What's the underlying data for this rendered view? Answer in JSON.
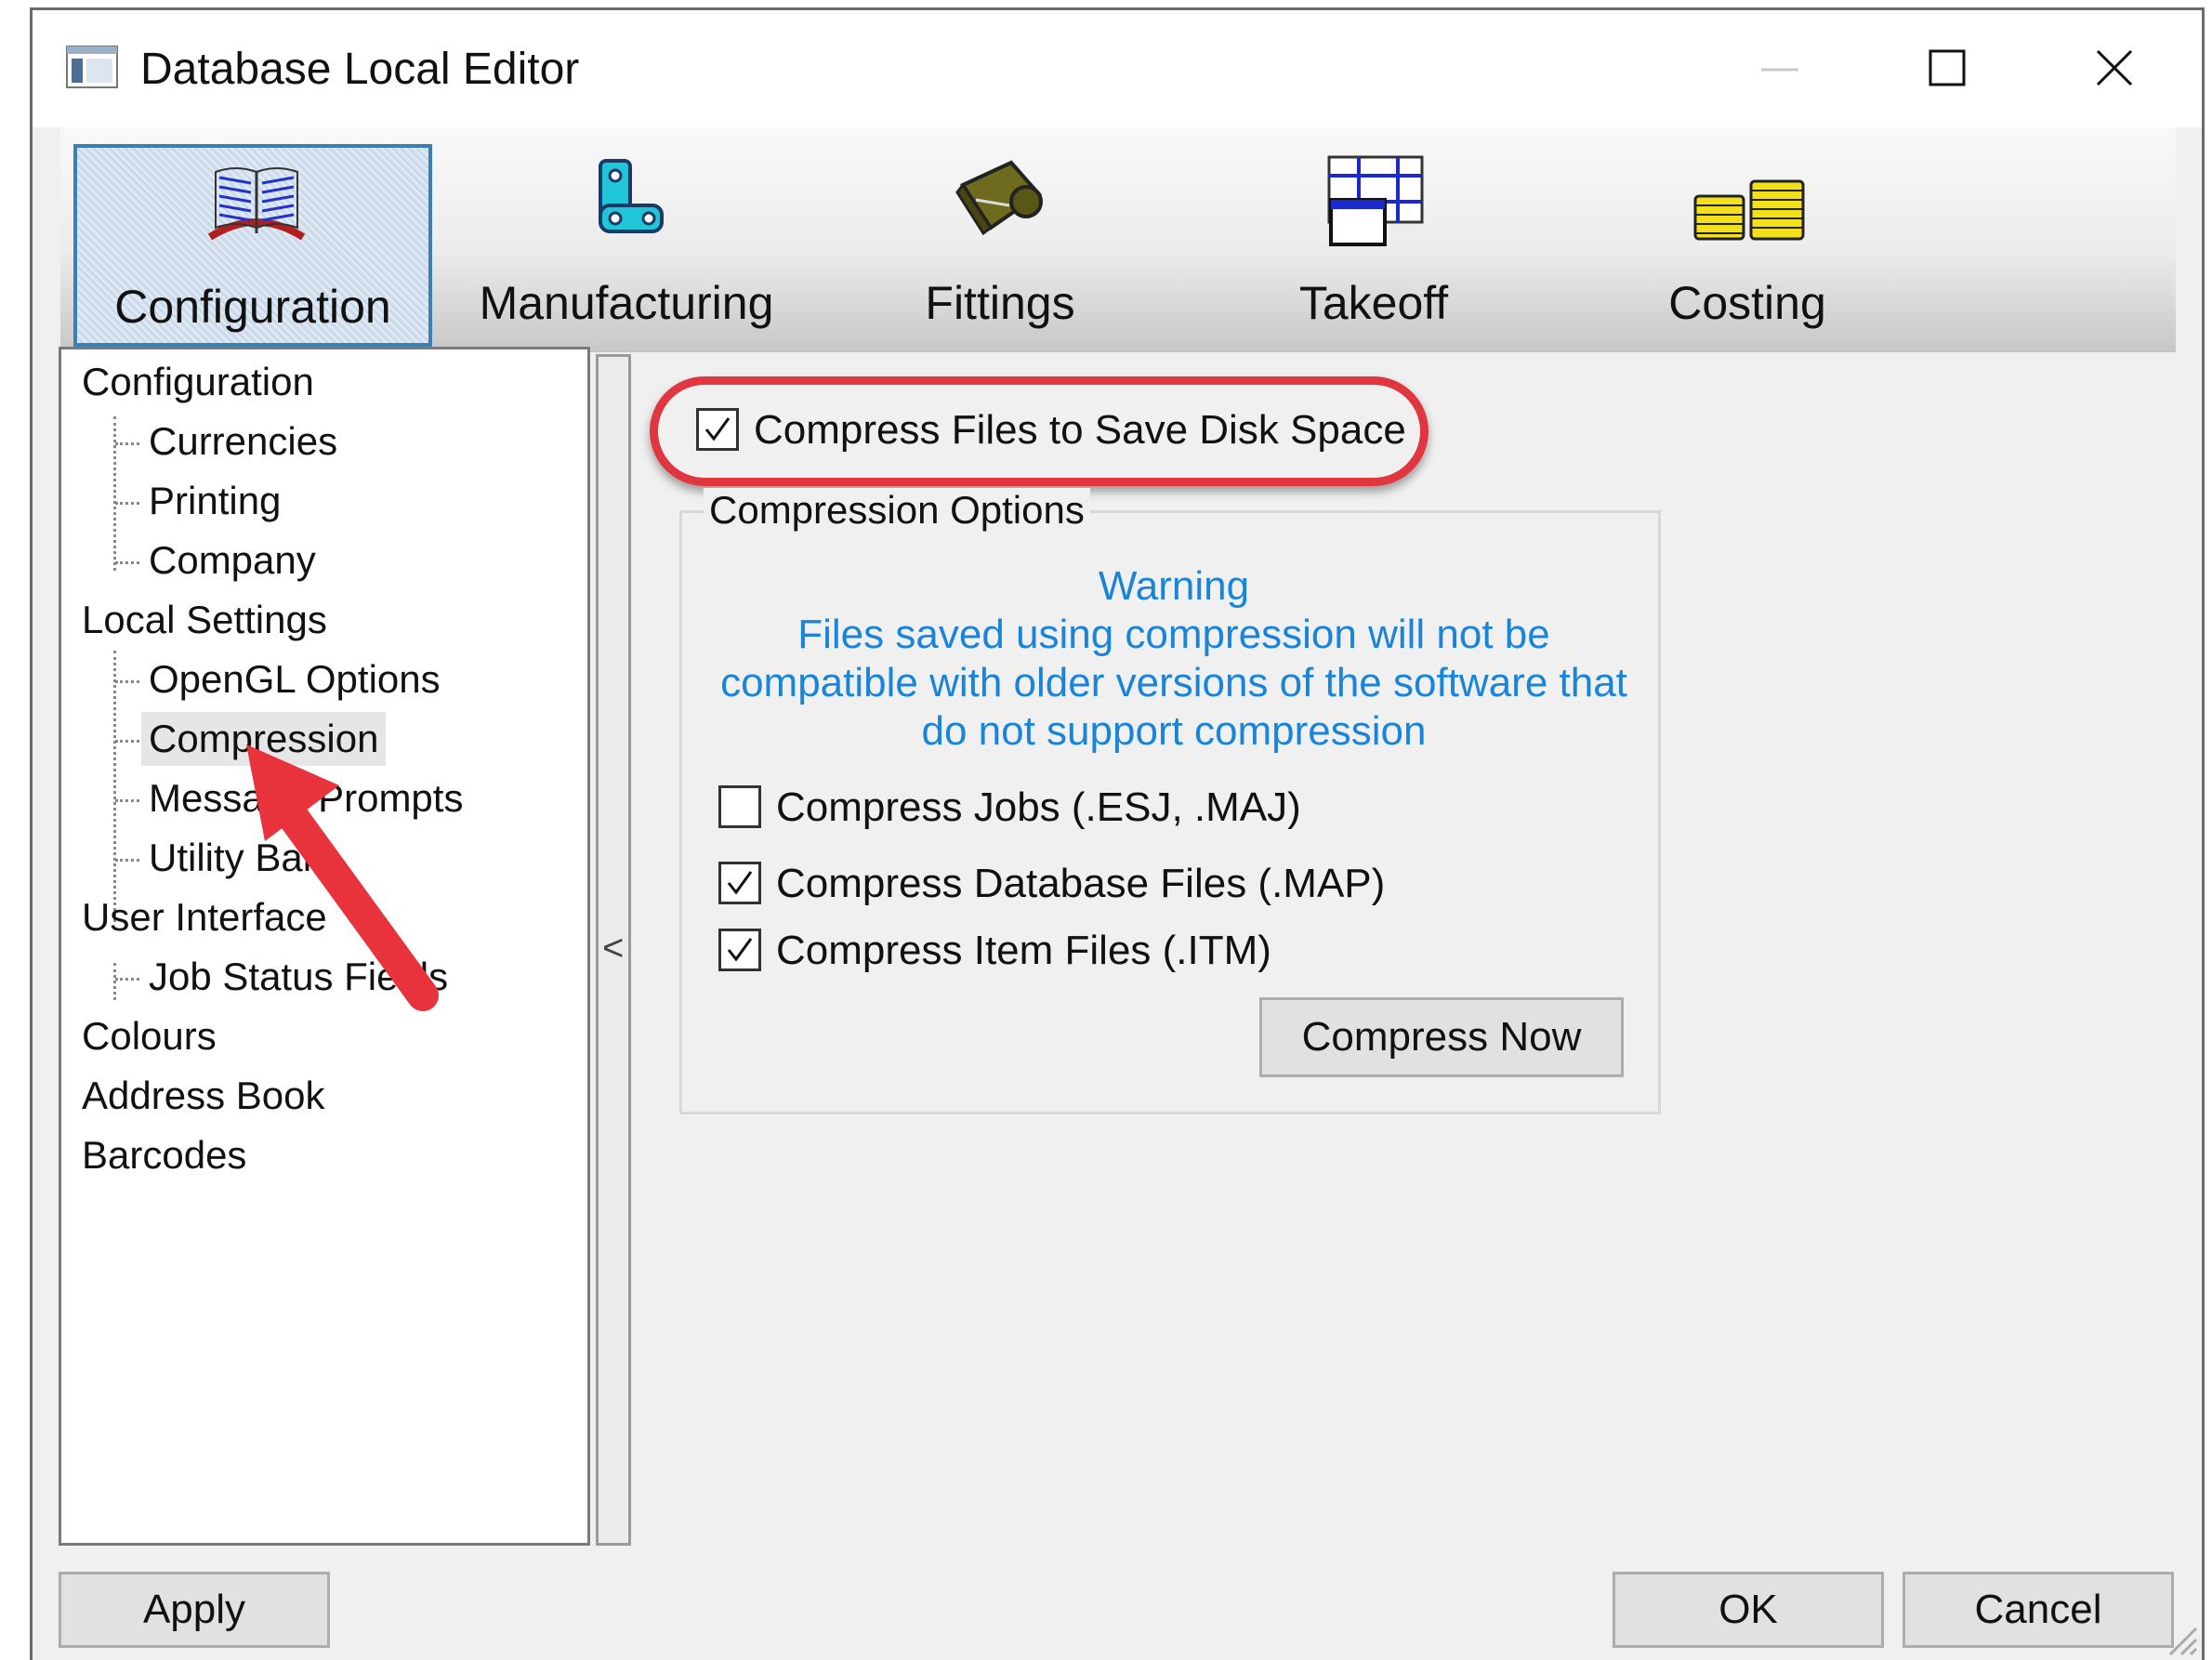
{
  "window": {
    "title": "Database Local Editor"
  },
  "toolbar": {
    "items": [
      {
        "label": "Configuration",
        "icon": "book-icon",
        "selected": true
      },
      {
        "label": "Manufacturing",
        "icon": "machine-icon",
        "selected": false
      },
      {
        "label": "Fittings",
        "icon": "duct-fitting-icon",
        "selected": false
      },
      {
        "label": "Takeoff",
        "icon": "takeoff-layout-icon",
        "selected": false
      },
      {
        "label": "Costing",
        "icon": "coins-icon",
        "selected": false
      }
    ]
  },
  "tree": {
    "items": [
      {
        "label": "Configuration",
        "level": 0
      },
      {
        "label": "Currencies",
        "level": 1
      },
      {
        "label": "Printing",
        "level": 1
      },
      {
        "label": "Company",
        "level": 1
      },
      {
        "label": "Local Settings",
        "level": 0
      },
      {
        "label": "OpenGL Options",
        "level": 1
      },
      {
        "label": "Compression",
        "level": 1,
        "selected": true
      },
      {
        "label": "Message Prompts",
        "level": 1
      },
      {
        "label": "Utility Bar",
        "level": 1
      },
      {
        "label": "User Interface",
        "level": 0
      },
      {
        "label": "Job Status Fields",
        "level": 1
      },
      {
        "label": "Colours",
        "level": 0
      },
      {
        "label": "Address Book",
        "level": 0
      },
      {
        "label": "Barcodes",
        "level": 0
      }
    ]
  },
  "splitter": {
    "glyph": "<"
  },
  "compression": {
    "main_checkbox": {
      "label": "Compress Files to Save Disk Space",
      "checked": true
    },
    "group_title": "Compression Options",
    "warning": {
      "title": "Warning",
      "lines": [
        "Files saved using compression will not be",
        "compatible with older versions of the software that",
        "do not support compression"
      ]
    },
    "options": [
      {
        "label": "Compress Jobs (.ESJ, .MAJ)",
        "checked": false
      },
      {
        "label": "Compress Database Files (.MAP)",
        "checked": true
      },
      {
        "label": "Compress Item Files (.ITM)",
        "checked": true
      }
    ],
    "compress_now_label": "Compress Now"
  },
  "buttons": {
    "apply": "Apply",
    "ok": "OK",
    "cancel": "Cancel"
  },
  "colors": {
    "warning_text": "#1a84d8",
    "highlight": "#e0363f",
    "selection_border": "#3c7fb1",
    "annotation_arrow": "#e8333c"
  }
}
